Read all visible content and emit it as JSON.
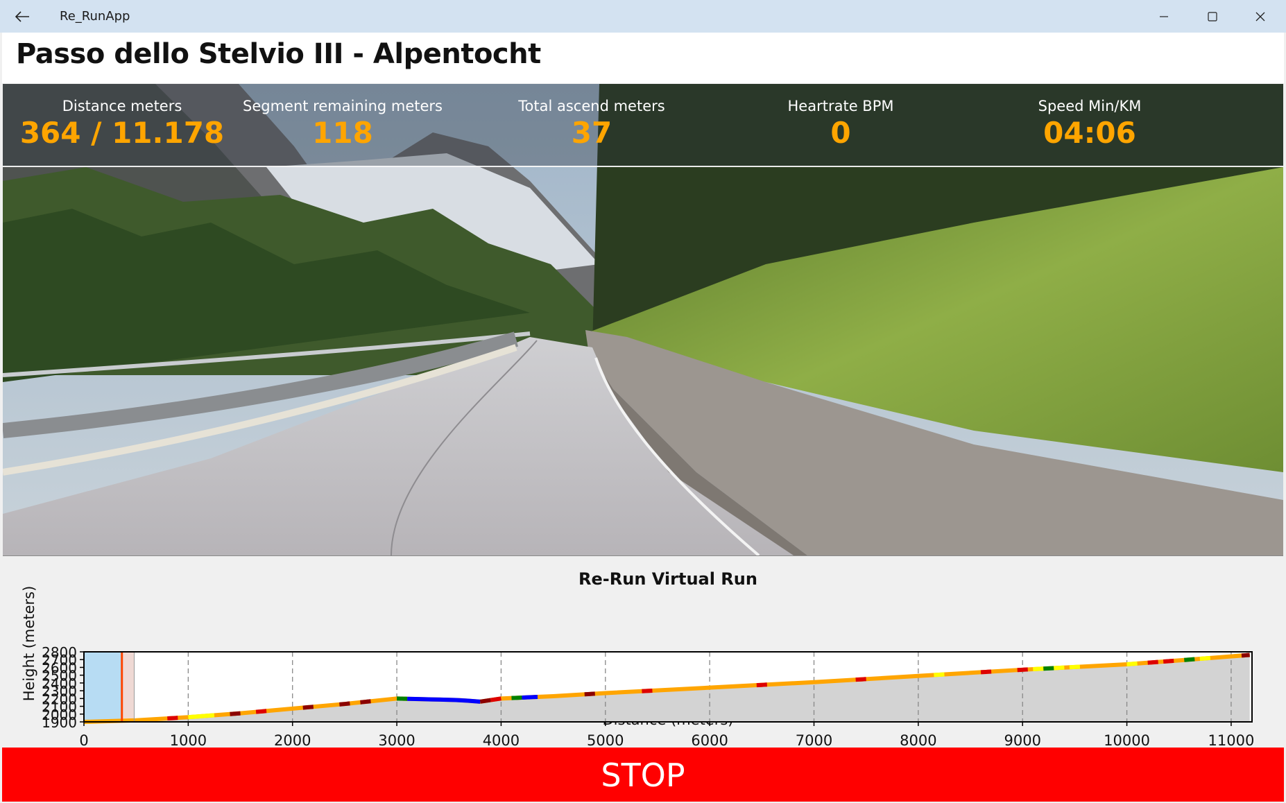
{
  "window": {
    "app_title": "Re_RunApp",
    "controls": [
      "minimize-icon",
      "maximize-icon",
      "close-icon"
    ]
  },
  "page": {
    "title": "Passo dello Stelvio III - Alpentocht"
  },
  "stats": [
    {
      "label": "Distance meters",
      "value": "364 / 11.178"
    },
    {
      "label": "Segment remaining meters",
      "value": "118"
    },
    {
      "label": "Total ascend meters",
      "value": "37"
    },
    {
      "label": "Heartrate BPM",
      "value": "0"
    },
    {
      "label": "Speed Min/KM",
      "value": "04:06"
    }
  ],
  "colors": {
    "accent_value": "#ffa500",
    "stop_button": "#ff0000",
    "title_bar": "#d3e2f1",
    "route_line": "#ffa500"
  },
  "chart_data": {
    "type": "line",
    "title": "Re-Run Virtual Run",
    "xlabel": "Distance (meters)",
    "ylabel": "Height (meters)",
    "xlim": [
      0,
      11200
    ],
    "ylim": [
      1900,
      2800
    ],
    "x_ticks": [
      0,
      1000,
      2000,
      3000,
      4000,
      5000,
      6000,
      7000,
      8000,
      9000,
      10000,
      11000
    ],
    "y_ticks": [
      1900,
      2000,
      2100,
      2200,
      2300,
      2400,
      2500,
      2600,
      2700,
      2800
    ],
    "x_tick_labels": [
      "0",
      "1000",
      "2000",
      "3000",
      "4000",
      "5000",
      "6000",
      "7000",
      "8000",
      "9000",
      "10000",
      "11000"
    ],
    "y_tick_labels": [
      "1900",
      "2000",
      "2100",
      "2200",
      "2300",
      "2400",
      "2500",
      "2600",
      "2700",
      "2800"
    ],
    "grid": "vertical dashed",
    "current_position": 364,
    "segment_end": 482,
    "series": [
      {
        "x": [
          0,
          500,
          1000,
          1500,
          2000,
          2500,
          3000,
          3300,
          3600,
          3800,
          4000,
          4500,
          5000,
          6000,
          7000,
          8000,
          9000,
          10000,
          10500,
          11178
        ],
        "values": [
          1900,
          1920,
          1960,
          2010,
          2070,
          2130,
          2200,
          2190,
          2180,
          2160,
          2200,
          2230,
          2270,
          2340,
          2410,
          2490,
          2570,
          2640,
          2690,
          2760
        ]
      }
    ],
    "segments": [
      {
        "from": 800,
        "to": 900,
        "color": "#dd0000"
      },
      {
        "from": 1000,
        "to": 1250,
        "color": "#ffff00"
      },
      {
        "from": 1400,
        "to": 1500,
        "color": "#8b0000"
      },
      {
        "from": 1650,
        "to": 1750,
        "color": "#dd0000"
      },
      {
        "from": 2100,
        "to": 2200,
        "color": "#8b0000"
      },
      {
        "from": 2450,
        "to": 2550,
        "color": "#8b0000"
      },
      {
        "from": 2650,
        "to": 2750,
        "color": "#8b0000"
      },
      {
        "from": 3000,
        "to": 3100,
        "color": "#008000"
      },
      {
        "from": 3100,
        "to": 3800,
        "color": "#0000ff"
      },
      {
        "from": 3800,
        "to": 3900,
        "color": "#8b0000"
      },
      {
        "from": 3900,
        "to": 4000,
        "color": "#dd0000"
      },
      {
        "from": 4100,
        "to": 4200,
        "color": "#008000"
      },
      {
        "from": 4200,
        "to": 4350,
        "color": "#0000ff"
      },
      {
        "from": 4800,
        "to": 4900,
        "color": "#8b0000"
      },
      {
        "from": 5350,
        "to": 5450,
        "color": "#dd0000"
      },
      {
        "from": 6450,
        "to": 6550,
        "color": "#dd0000"
      },
      {
        "from": 7400,
        "to": 7500,
        "color": "#dd0000"
      },
      {
        "from": 8150,
        "to": 8250,
        "color": "#ffff00"
      },
      {
        "from": 8600,
        "to": 8700,
        "color": "#dd0000"
      },
      {
        "from": 8950,
        "to": 9050,
        "color": "#dd0000"
      },
      {
        "from": 9100,
        "to": 9200,
        "color": "#ffff00"
      },
      {
        "from": 9200,
        "to": 9300,
        "color": "#008000"
      },
      {
        "from": 9300,
        "to": 9400,
        "color": "#ffff00"
      },
      {
        "from": 9450,
        "to": 9550,
        "color": "#ffff00"
      },
      {
        "from": 10000,
        "to": 10100,
        "color": "#ffff00"
      },
      {
        "from": 10200,
        "to": 10300,
        "color": "#dd0000"
      },
      {
        "from": 10350,
        "to": 10450,
        "color": "#dd0000"
      },
      {
        "from": 10550,
        "to": 10650,
        "color": "#008000"
      },
      {
        "from": 10700,
        "to": 10800,
        "color": "#ffff00"
      },
      {
        "from": 11100,
        "to": 11178,
        "color": "#8b0000"
      }
    ]
  },
  "stop_button": {
    "label": "STOP"
  }
}
